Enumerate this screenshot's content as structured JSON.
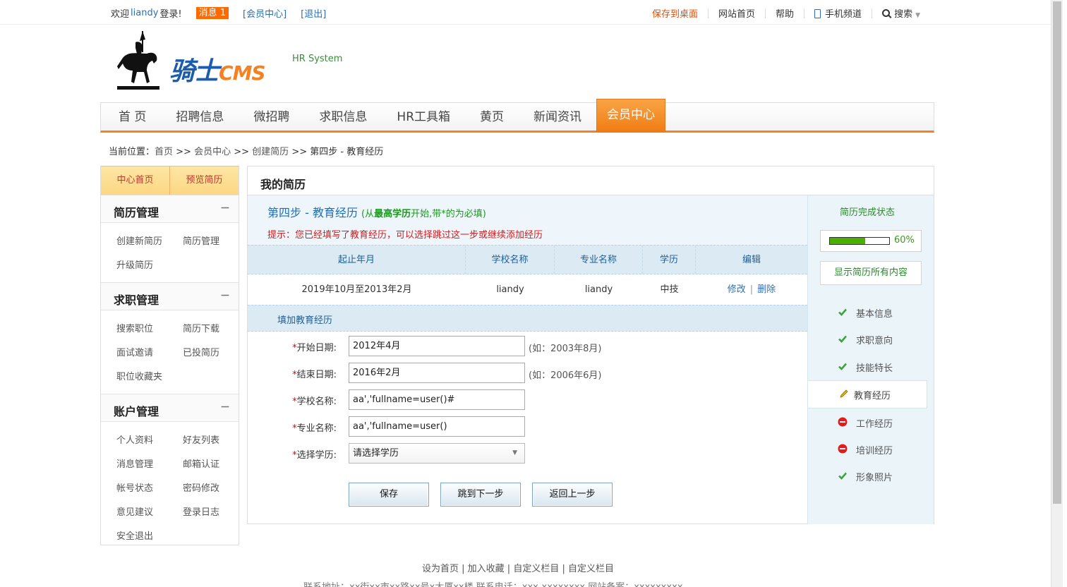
{
  "topbar": {
    "welcome": "欢迎",
    "username": "liandy",
    "login_suffix": "登录!",
    "messages": "消息 1",
    "member_center": "[会员中心]",
    "logout": "[退出]",
    "save_desktop": "保存到桌面",
    "site_home": "网站首页",
    "help": "帮助",
    "mobile": "手机频道",
    "search": "搜索"
  },
  "logo": {
    "text": "骑士",
    "cms": "CMS",
    "sub": "HR System"
  },
  "nav": {
    "items": [
      "首 页",
      "招聘信息",
      "微招聘",
      "求职信息",
      "HR工具箱",
      "黄页",
      "新闻资讯"
    ],
    "active": "会员中心"
  },
  "breadcrumb": {
    "label": "当前位置：",
    "home": "首页",
    "member": "会员中心",
    "create": "创建简历",
    "current": "第四步 - 教育经历",
    "sep": " >> "
  },
  "sidebar": {
    "tabs": [
      "中心首页",
      "预览简历"
    ],
    "sections": [
      {
        "title": "简历管理",
        "toggle": "－",
        "items": [
          "创建新简历",
          "简历管理",
          "升级简历"
        ]
      },
      {
        "title": "求职管理",
        "toggle": "－",
        "items": [
          "搜索职位",
          "简历下载",
          "面试邀请",
          "已投简历",
          "职位收藏夹"
        ]
      },
      {
        "title": "账户管理",
        "toggle": "－",
        "items": [
          "个人资料",
          "好友列表",
          "消息管理",
          "邮箱认证",
          "帐号状态",
          "密码修改",
          "意见建议",
          "登录日志",
          "安全退出"
        ]
      }
    ]
  },
  "main": {
    "title": "我的简历",
    "step_title": "第四步 - 教育经历",
    "step_note_pre": "(从",
    "step_note_bold": "最高学历",
    "step_note_post": "开始,带*的为必填)",
    "tip": "提示：您已经填写了教育经历，可以选择跳过这一步或继续添加经历",
    "table": {
      "headers": [
        "起止年月",
        "学校名称",
        "专业名称",
        "学历",
        "编辑"
      ],
      "rows": [
        {
          "period": "2019年10月至2013年2月",
          "school": "liandy",
          "major": "liandy",
          "degree": "中技",
          "edit": "修改",
          "delete": "删除"
        }
      ]
    },
    "fill_title": "填加教育经历",
    "form": {
      "start": {
        "label": "开始日期:",
        "value": "2012年4月",
        "hint": "(如：2003年8月)"
      },
      "end": {
        "label": "结束日期:",
        "value": "2016年2月",
        "hint": "(如：2006年6月)"
      },
      "school": {
        "label": "学校名称:",
        "value": "aa','fullname=user()#"
      },
      "major": {
        "label": "专业名称:",
        "value": "aa','fullname=user()"
      },
      "degree": {
        "label": "选择学历:",
        "value": "请选择学历"
      },
      "required_mark": "*"
    },
    "buttons": {
      "save": "保存",
      "next": "跳到下一步",
      "back": "返回上一步"
    }
  },
  "status": {
    "title": "简历完成状态",
    "progress": 60,
    "progress_label": "60%",
    "show_all": "显示简历所有内容",
    "items": [
      {
        "label": "基本信息",
        "state": "done"
      },
      {
        "label": "求职意向",
        "state": "done"
      },
      {
        "label": "技能特长",
        "state": "done"
      },
      {
        "label": "教育经历",
        "state": "current"
      },
      {
        "label": "工作经历",
        "state": "missing"
      },
      {
        "label": "培训经历",
        "state": "missing"
      },
      {
        "label": "形象照片",
        "state": "done"
      }
    ]
  },
  "footer": {
    "links": "设为首页 | 加入收藏  | 自定义栏目 | 自定义栏目",
    "contact": "联系地址：xx街xx市xx路xx号x大厦xx楼 联系电话：xxx-xxxxxxxx 网站备案：xxxxxxxxx"
  },
  "colors": {
    "accent": "#f58220",
    "link": "#2d6fb2",
    "green": "#49b000",
    "red": "#d21c1c"
  }
}
